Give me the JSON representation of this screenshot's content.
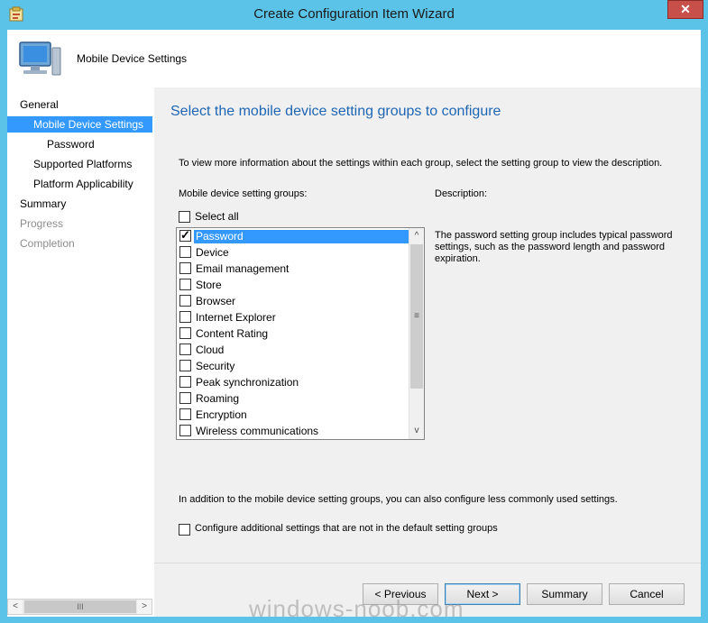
{
  "window": {
    "title": "Create Configuration Item Wizard",
    "close_glyph": "✕"
  },
  "header": {
    "title": "Mobile Device Settings"
  },
  "nav": {
    "items": [
      {
        "label": "General",
        "state": "normal"
      },
      {
        "label": "Mobile Device Settings",
        "state": "selected"
      },
      {
        "label": "Password",
        "state": "normal"
      },
      {
        "label": "Supported Platforms",
        "state": "normal"
      },
      {
        "label": "Platform Applicability",
        "state": "normal"
      },
      {
        "label": "Summary",
        "state": "normal"
      },
      {
        "label": "Progress",
        "state": "disabled"
      },
      {
        "label": "Completion",
        "state": "disabled"
      }
    ],
    "scroll_left": "<",
    "scroll_right": ">",
    "scroll_grip": "III"
  },
  "main": {
    "title": "Select the mobile device setting groups to configure",
    "intro": "To view more information about the settings within each group, select the setting group to view the description.",
    "groups_label": "Mobile device setting groups:",
    "description_label": "Description:",
    "select_all": {
      "label": "Select all",
      "checked": false
    },
    "groups": [
      {
        "label": "Password",
        "checked": true,
        "selected": true
      },
      {
        "label": "Device",
        "checked": false,
        "selected": false
      },
      {
        "label": "Email management",
        "checked": false,
        "selected": false
      },
      {
        "label": "Store",
        "checked": false,
        "selected": false
      },
      {
        "label": "Browser",
        "checked": false,
        "selected": false
      },
      {
        "label": "Internet Explorer",
        "checked": false,
        "selected": false
      },
      {
        "label": "Content Rating",
        "checked": false,
        "selected": false
      },
      {
        "label": "Cloud",
        "checked": false,
        "selected": false
      },
      {
        "label": "Security",
        "checked": false,
        "selected": false
      },
      {
        "label": "Peak synchronization",
        "checked": false,
        "selected": false
      },
      {
        "label": "Roaming",
        "checked": false,
        "selected": false
      },
      {
        "label": "Encryption",
        "checked": false,
        "selected": false
      },
      {
        "label": "Wireless communications",
        "checked": false,
        "selected": false
      }
    ],
    "description": "The password setting group includes typical password settings, such as the password length and password expiration.",
    "more_text": "In addition to the mobile device setting groups, you can also configure less commonly used settings.",
    "additional": {
      "label": "Configure additional settings that are not in the default setting groups",
      "checked": false
    },
    "scroll_up": "^",
    "scroll_down": "v",
    "scroll_grip": "≡"
  },
  "footer": {
    "previous": "< Previous",
    "next": "Next >",
    "summary": "Summary",
    "cancel": "Cancel"
  },
  "watermark": "windows-noob.com"
}
